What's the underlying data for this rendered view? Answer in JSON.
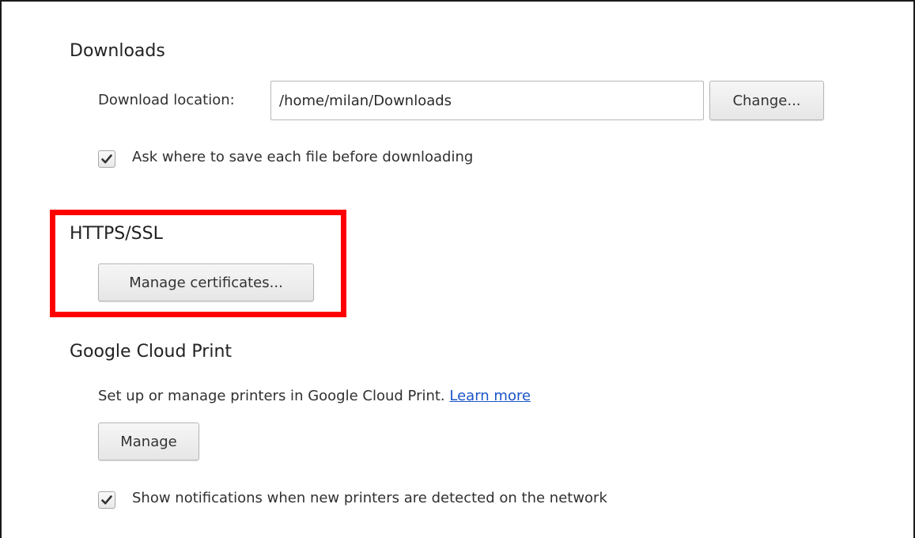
{
  "downloads": {
    "title": "Downloads",
    "location_label": "Download location:",
    "location_value": "/home/milan/Downloads",
    "change_button": "Change...",
    "ask_checkbox_label": "Ask where to save each file before downloading",
    "ask_checked": true
  },
  "https": {
    "title": "HTTPS/SSL",
    "manage_certificates_button": "Manage certificates..."
  },
  "cloud_print": {
    "title": "Google Cloud Print",
    "description": "Set up or manage printers in Google Cloud Print.",
    "learn_more_link": "Learn more",
    "manage_button": "Manage",
    "notifications_checkbox_label": "Show notifications when new printers are detected on the network",
    "notifications_checked": true
  },
  "colors": {
    "highlight": "#ff0000",
    "link": "#1a55c8"
  },
  "icons": {
    "checkmark": "checkmark-icon"
  }
}
